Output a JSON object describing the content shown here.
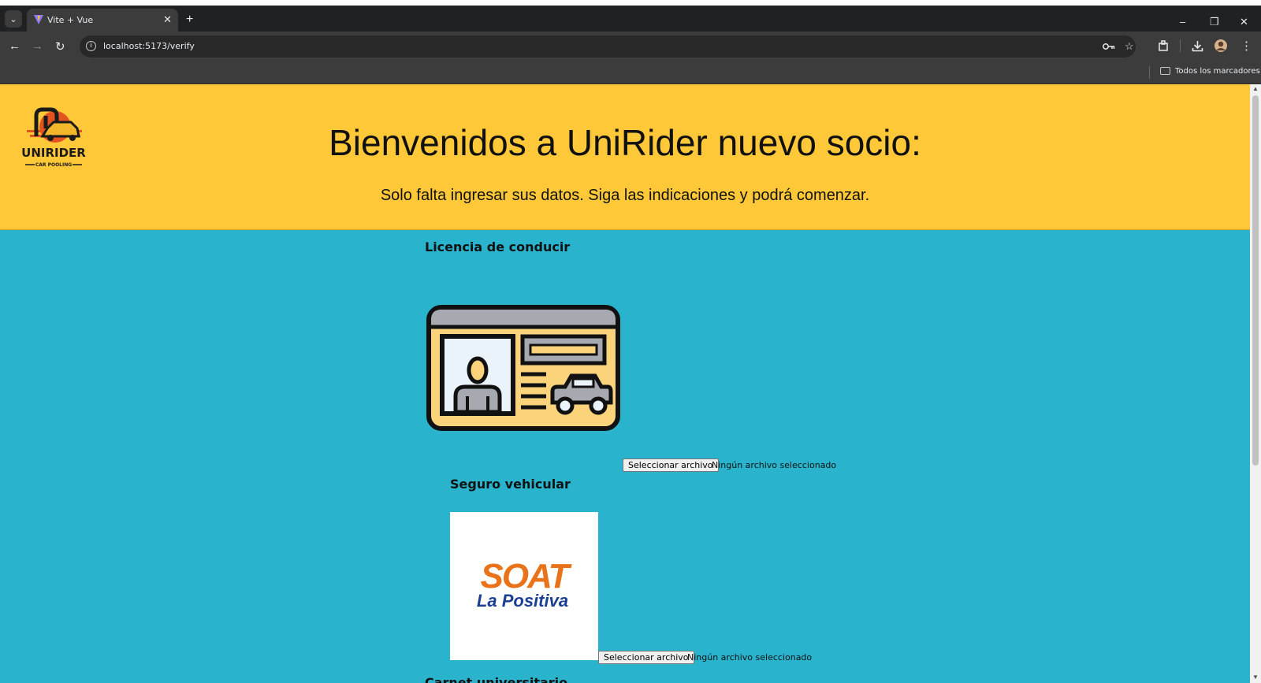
{
  "browser": {
    "tab_title": "Vite + Vue",
    "tab_close": "✕",
    "new_tab": "+",
    "url": "localhost:5173/verify",
    "bookmarks_label": "Todos los marcadores",
    "win_min": "–",
    "win_restore": "❐",
    "win_close": "✕",
    "back": "←",
    "forward": "→",
    "reload": "↻"
  },
  "header": {
    "logo_text": "UNIRIDER",
    "logo_tagline": "CAR POOLING",
    "title": "Bienvenidos a UniRider nuevo socio:",
    "subtitle": "Solo falta ingresar sus datos. Siga las indicaciones y podrá comenzar."
  },
  "sections": {
    "license": {
      "title": "Licencia de conducir",
      "button": "Seleccionar archivo",
      "status": "Ningún archivo seleccionado"
    },
    "insurance": {
      "title": "Seguro vehicular",
      "logo_main": "SOAT",
      "logo_sub": "La Positiva",
      "button": "Seleccionar archivo",
      "status": "Ningún archivo seleccionado"
    },
    "next_title_partial": "Carnet universitario"
  },
  "colors": {
    "header_bg": "#ffc838",
    "page_bg": "#2ab3cd"
  }
}
